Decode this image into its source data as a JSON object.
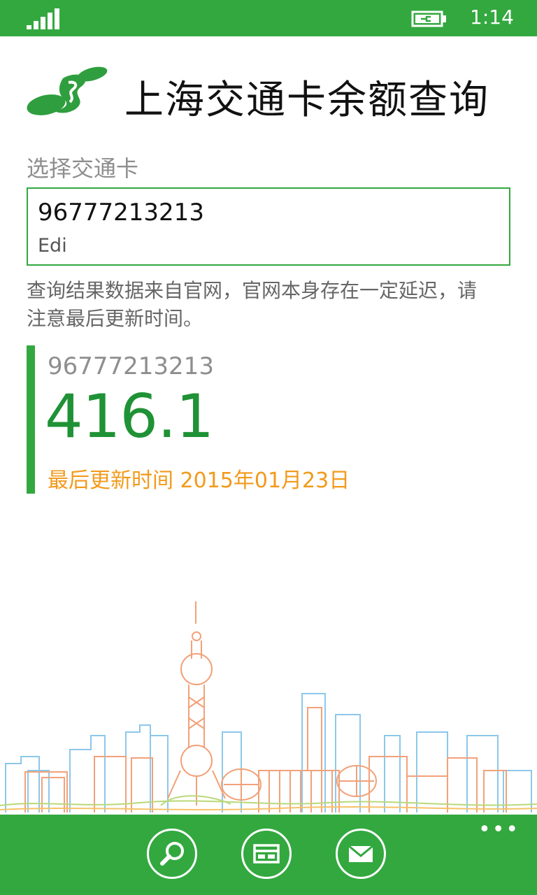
{
  "status_bar": {
    "time": "1:14"
  },
  "header": {
    "title": "上海交通卡余额查询"
  },
  "card_selector": {
    "label": "选择交通卡",
    "selected_number": "96777213213",
    "selected_name": "Edi"
  },
  "notice": {
    "text": "查询结果数据来自官网，官网本身存在一定延迟，请注意最后更新时间。"
  },
  "result": {
    "card_number": "96777213213",
    "balance": "416.1",
    "updated": "最后更新时间 2015年01月23日"
  },
  "app_bar": {
    "buttons": [
      {
        "icon": "search-icon"
      },
      {
        "icon": "card-icon"
      },
      {
        "icon": "mail-icon"
      }
    ],
    "more": "•••"
  },
  "colors": {
    "accent": "#33a83f",
    "balance": "#1f9236",
    "updated": "#f29a1b"
  }
}
